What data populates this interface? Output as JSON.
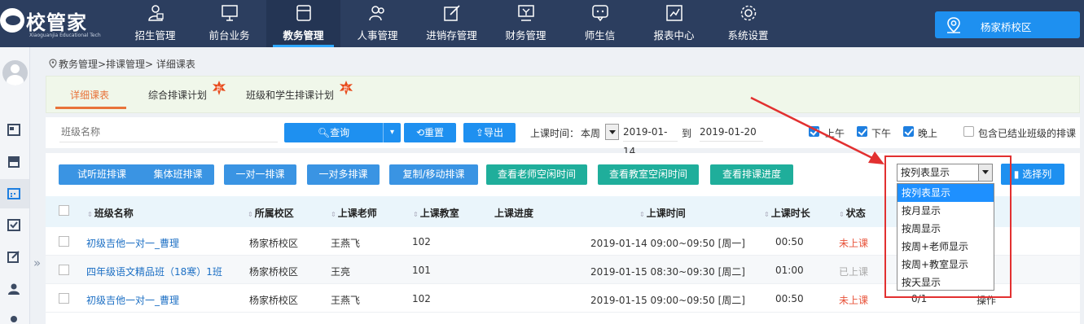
{
  "app": {
    "logo_name": "校管家",
    "logo_sub": "Xiaoguanjia Educational Tech"
  },
  "nav": [
    {
      "label": "招生管理",
      "icon": "enroll-icon"
    },
    {
      "label": "前台业务",
      "icon": "monitor-icon"
    },
    {
      "label": "教务管理",
      "icon": "schedule-icon",
      "active": true
    },
    {
      "label": "人事管理",
      "icon": "people-icon"
    },
    {
      "label": "进销存管理",
      "icon": "edit-icon"
    },
    {
      "label": "财务管理",
      "icon": "finance-icon"
    },
    {
      "label": "师生信",
      "icon": "message-icon"
    },
    {
      "label": "报表中心",
      "icon": "report-icon"
    },
    {
      "label": "系统设置",
      "icon": "gear-icon"
    }
  ],
  "campus": {
    "label": "杨家桥校区"
  },
  "breadcrumb": "教务管理>排课管理> 详细课表",
  "tabs": [
    {
      "label": "详细课表",
      "active": true
    },
    {
      "label": "综合排课计划",
      "badge": "新"
    },
    {
      "label": "班级和学生排课计划",
      "badge": "新"
    }
  ],
  "filters": {
    "class_placeholder": "班级名称",
    "query": "查询",
    "reset": "重置",
    "export": "导出",
    "time_label": "上课时间：",
    "period": "本周",
    "date_from": "2019-01-14",
    "date_to_label": "到",
    "date_to": "2019-01-20",
    "am": "上午",
    "pm": "下午",
    "night": "晚上",
    "include_finished": "包含已结业班级的排课"
  },
  "actions": [
    {
      "label": "试听班排课",
      "color": "blue"
    },
    {
      "label": "集体班排课",
      "color": "blue"
    },
    {
      "label": "一对一排课",
      "color": "blue"
    },
    {
      "label": "一对多排课",
      "color": "blue"
    },
    {
      "label": "复制/移动排课",
      "color": "blue"
    },
    {
      "label": "查看老师空闲时间",
      "color": "teal"
    },
    {
      "label": "查看教室空闲时间",
      "color": "teal"
    },
    {
      "label": "查看排课进度",
      "color": "teal"
    }
  ],
  "view_select": {
    "value": "按列表显示",
    "options": [
      "按列表显示",
      "按月显示",
      "按周显示",
      "按周+老师显示",
      "按周+教室显示",
      "按天显示"
    ]
  },
  "choose_columns": "选择列",
  "table": {
    "headers": [
      "班级名称",
      "所属校区",
      "上课老师",
      "上课教室",
      "上课进度",
      "上课时间",
      "上课时长",
      "状态"
    ],
    "rows": [
      {
        "class": "初级吉他一对一_曹理",
        "campus": "杨家桥校区",
        "teacher": "王燕飞",
        "room": "102",
        "time": "2019-01-14 09:00~09:50 [周一]",
        "duration": "00:50",
        "status": "未上课",
        "status_type": "red"
      },
      {
        "class": "四年级语文精品班（18寒）1班",
        "campus": "杨家桥校区",
        "teacher": "王亮",
        "room": "101",
        "time": "2019-01-15 08:30~09:30 [周二]",
        "duration": "01:00",
        "status": "已上课",
        "status_type": "gray"
      },
      {
        "class": "初级吉他一对一_曹理",
        "campus": "杨家桥校区",
        "teacher": "王燕飞",
        "room": "102",
        "time": "2019-01-15 09:00~09:50 [周二]",
        "duration": "00:50",
        "status": "未上课",
        "status_type": "red",
        "progress": "0/1",
        "op": "操作"
      }
    ]
  },
  "colors": {
    "topbar": "#2c3e5f",
    "accent": "#1e90f0",
    "orange": "#e8733a",
    "highlight_box": "#e23030"
  }
}
